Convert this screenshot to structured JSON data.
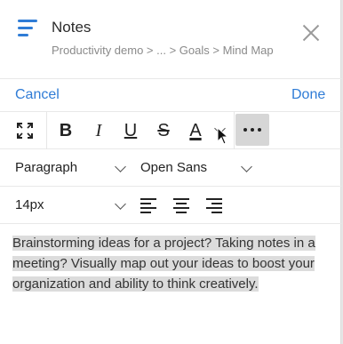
{
  "header": {
    "title": "Notes",
    "breadcrumb": "Productivity demo > ... > Goals > Mind Map",
    "icons": [
      "menu-icon",
      "close-icon"
    ]
  },
  "actions": {
    "cancel_label": "Cancel",
    "done_label": "Done"
  },
  "toolbar": {
    "bold": "B",
    "italic": "I",
    "underline": "U",
    "strikethrough": "S",
    "text_color": "A",
    "icons": [
      "fullscreen-icon",
      "more-icon",
      "chevron-down-icon"
    ]
  },
  "block_format": {
    "paragraph_value": "Paragraph",
    "font_value": "Open Sans"
  },
  "size_format": {
    "font_size_value": "14px",
    "alignments": [
      "align-left-icon",
      "align-center-icon",
      "align-right-icon"
    ]
  },
  "content": {
    "text": "Brainstorming ideas for a project? Taking notes in a meeting? Visually map out your ideas to boost your organization and ability to think creatively."
  },
  "colors": {
    "accent": "#2f7cd6",
    "selection": "#dcdcdc",
    "more_active_bg": "#d6d6d6"
  }
}
